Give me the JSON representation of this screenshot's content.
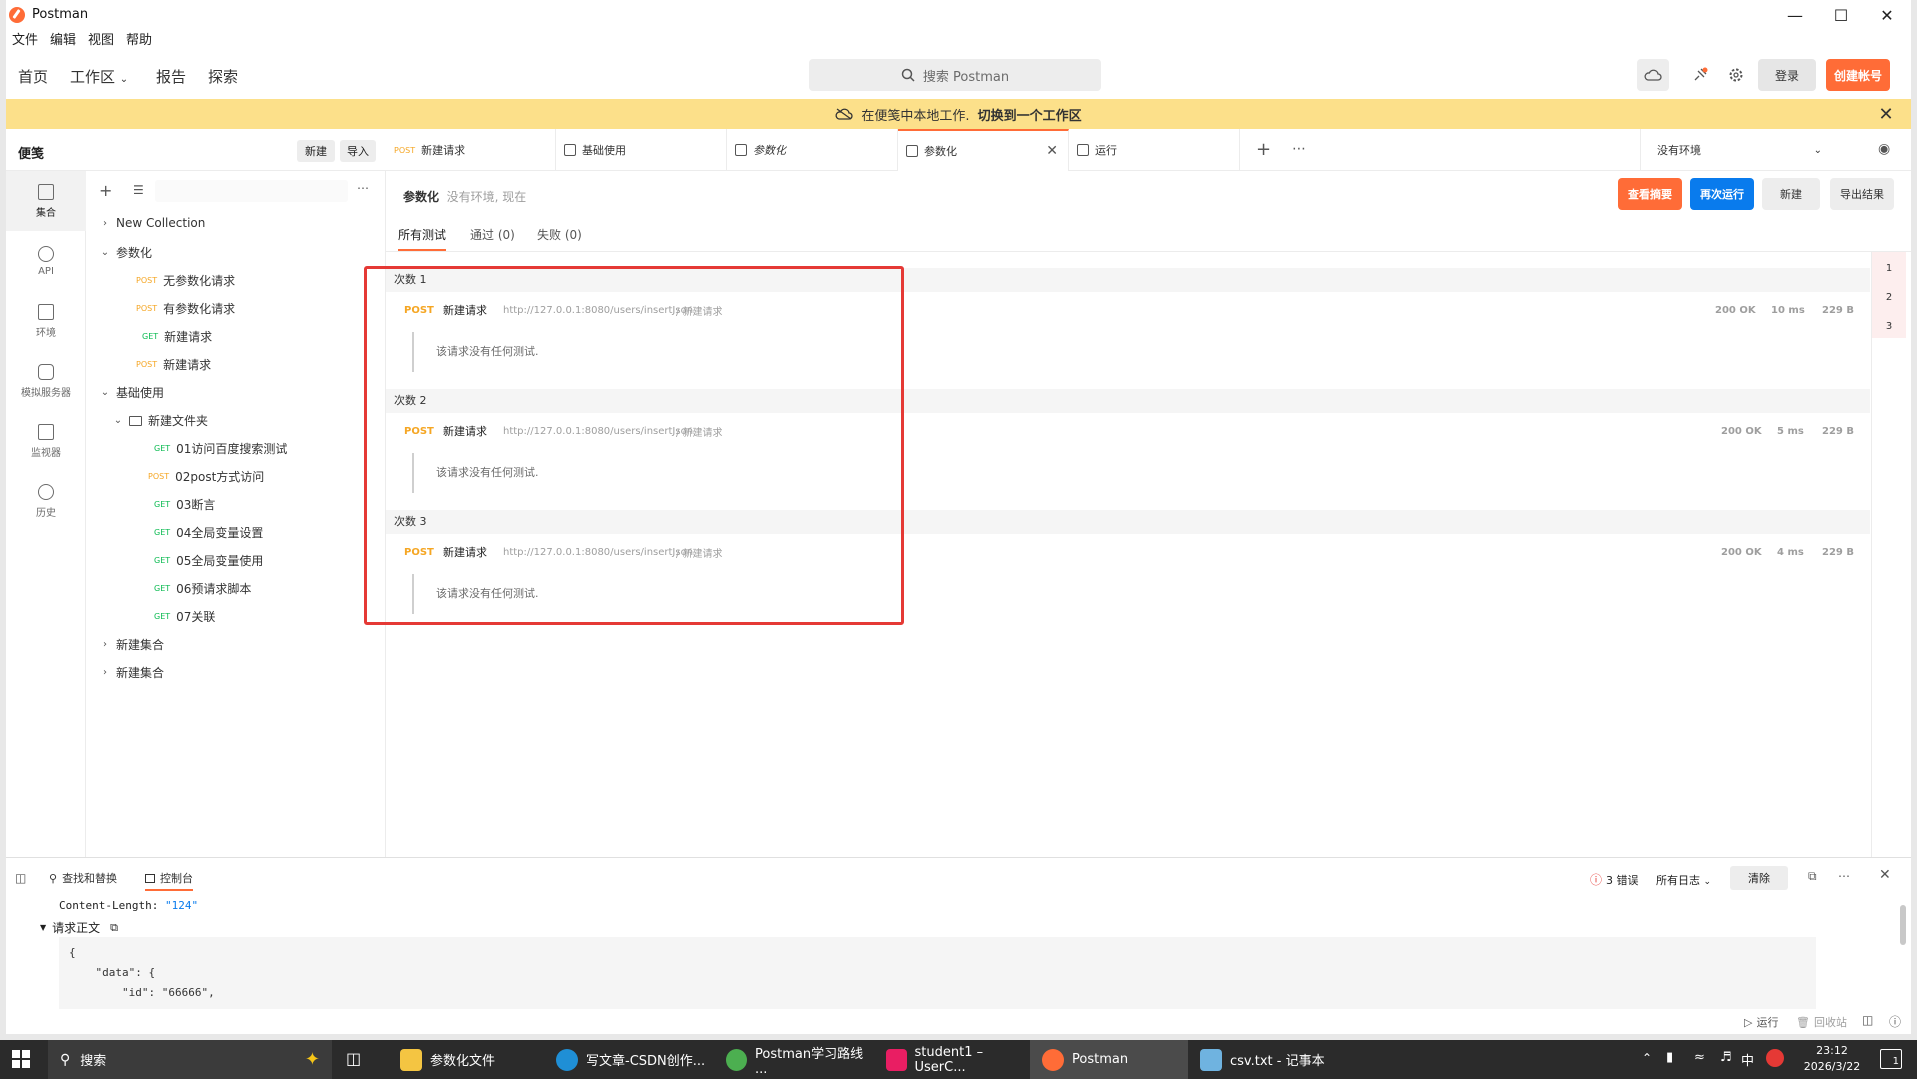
{
  "window": {
    "title": "Postman"
  },
  "menubar": [
    "文件",
    "编辑",
    "视图",
    "帮助"
  ],
  "header": {
    "nav": [
      "首页",
      "工作区",
      "报告",
      "探索"
    ],
    "search_placeholder": "搜索 Postman",
    "login": "登录",
    "signup": "创建帐号"
  },
  "banner": {
    "text": "在便笺中本地工作.",
    "link": "切换到一个工作区"
  },
  "sidebar": {
    "title": "便笺",
    "new": "新建",
    "import": "导入",
    "rail": [
      "集合",
      "API",
      "环境",
      "模拟服务器",
      "监视器",
      "历史"
    ],
    "tree": [
      {
        "label": "New Collection",
        "method": "",
        "expanded": false,
        "kind": "collection"
      },
      {
        "label": "参数化",
        "method": "",
        "expanded": true,
        "kind": "collection"
      },
      {
        "label": "无参数化请求",
        "method": "POST",
        "kind": "request"
      },
      {
        "label": "有参数化请求",
        "method": "POST",
        "kind": "request"
      },
      {
        "label": "新建请求",
        "method": "GET",
        "kind": "request"
      },
      {
        "label": "新建请求",
        "method": "POST",
        "kind": "request"
      },
      {
        "label": "基础使用",
        "method": "",
        "expanded": true,
        "kind": "collection"
      },
      {
        "label": "新建文件夹",
        "method": "",
        "expanded": true,
        "kind": "folder"
      },
      {
        "label": "01访问百度搜索测试",
        "method": "GET",
        "kind": "request"
      },
      {
        "label": "02post方式访问",
        "method": "POST",
        "kind": "request"
      },
      {
        "label": "03断言",
        "method": "GET",
        "kind": "request"
      },
      {
        "label": "04全局变量设置",
        "method": "GET",
        "kind": "request"
      },
      {
        "label": "05全局变量使用",
        "method": "GET",
        "kind": "request"
      },
      {
        "label": "06预请求脚本",
        "method": "GET",
        "kind": "request"
      },
      {
        "label": "07关联",
        "method": "GET",
        "kind": "request"
      },
      {
        "label": "新建集合",
        "method": "",
        "expanded": false,
        "kind": "collection"
      },
      {
        "label": "新建集合",
        "method": "",
        "expanded": false,
        "kind": "collection"
      }
    ]
  },
  "tabs": [
    {
      "method": "POST",
      "label": "新建请求"
    },
    {
      "method": "",
      "label": "基础使用"
    },
    {
      "method": "",
      "label": "参数化"
    },
    {
      "method": "",
      "label": "参数化",
      "active": true
    },
    {
      "method": "",
      "label": "运行"
    }
  ],
  "environment": "没有环境",
  "runner": {
    "title": "参数化",
    "subtitle": "没有环境, 现在",
    "buttons": {
      "summary": "查看摘要",
      "rerun": "再次运行",
      "new": "新建",
      "export": "导出结果"
    },
    "subtabs": [
      "所有测试",
      "通过 (0)",
      "失败 (0)"
    ],
    "iterations": [
      {
        "label": "次数 1",
        "method": "POST",
        "name": "新建请求",
        "url": "http://127.0.0.1:8080/users/insertJson",
        "path": "/ 新建请求",
        "status": "200 OK",
        "time": "10 ms",
        "size": "229 B",
        "note": "该请求没有任何测试."
      },
      {
        "label": "次数 2",
        "method": "POST",
        "name": "新建请求",
        "url": "http://127.0.0.1:8080/users/insertJson",
        "path": "/ 新建请求",
        "status": "200 OK",
        "time": "5 ms",
        "size": "229 B",
        "note": "该请求没有任何测试."
      },
      {
        "label": "次数 3",
        "method": "POST",
        "name": "新建请求",
        "url": "http://127.0.0.1:8080/users/insertJson",
        "path": "/ 新建请求",
        "status": "200 OK",
        "time": "4 ms",
        "size": "229 B",
        "note": "该请求没有任何测试."
      }
    ],
    "ruler": [
      "1",
      "2",
      "3"
    ]
  },
  "console": {
    "tabs": [
      "查找和替换",
      "控制台"
    ],
    "errors": "3 错误",
    "log_filter": "所有日志",
    "clear": "清除",
    "content_length_key": "Content-Length:",
    "content_length_val": "\"124\"",
    "body_label": "请求正文",
    "code": "{\n    \"data\": {\n        \"id\": \"66666\","
  },
  "statusbar": {
    "run": "运行",
    "trash": "回收站"
  },
  "taskbar": {
    "search": "搜索",
    "tasks": [
      "参数化文件",
      "写文章-CSDN创作...",
      "Postman学习路线 ...",
      "student1 – UserC...",
      "Postman",
      "csv.txt - 记事本"
    ],
    "ime": "中",
    "time": "23:12",
    "date": "2026/3/22",
    "notif": "1"
  },
  "colors": {
    "accent": "#ff6c37",
    "primary": "#097bed",
    "post": "#f5a623",
    "get": "#0cbb52",
    "banner": "#fce08a",
    "highlight": "#e53935"
  }
}
